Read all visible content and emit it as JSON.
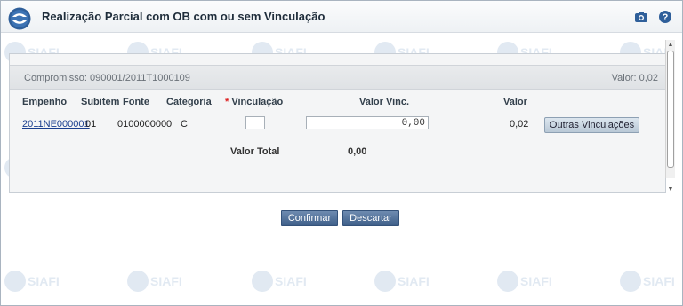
{
  "header": {
    "title": "Realização Parcial com OB com ou sem Vinculação",
    "logo_icon": "sigma-logo-icon",
    "camera_icon": "camera-icon",
    "help_icon": "help-icon"
  },
  "watermark": {
    "text": "SIAFI"
  },
  "compromisso": {
    "label": "Compromisso: 090001/2011T1000109",
    "valor": "Valor: 0,02"
  },
  "table": {
    "headers": {
      "empenho": "Empenho",
      "subitem": "Subitem",
      "fonte": "Fonte",
      "categoria": "Categoria",
      "vinculacao_required": "*",
      "vinculacao": "Vinculação",
      "valor_vinc": "Valor Vinc.",
      "valor": "Valor"
    },
    "row": {
      "empenho": "2011NE000001",
      "subitem": "01",
      "fonte": "0100000000",
      "categoria": "C",
      "vinculacao": "",
      "valor_vinc": "0,00",
      "valor": "0,02",
      "outras_button": "Outras Vinculações"
    },
    "total": {
      "label": "Valor Total",
      "value": "0,00"
    }
  },
  "actions": {
    "confirm": "Confirmar",
    "discard": "Descartar"
  },
  "colors": {
    "accent": "#3f5f89",
    "link": "#1a3f8f",
    "required": "#d22222"
  }
}
